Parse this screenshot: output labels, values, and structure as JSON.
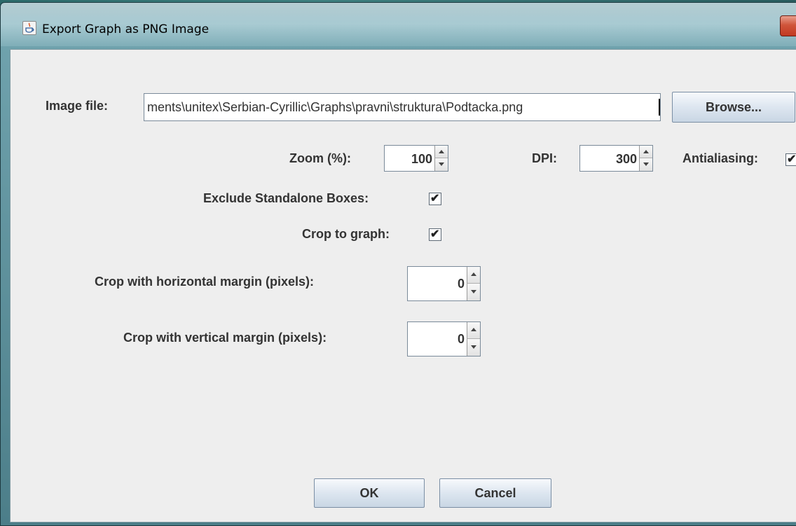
{
  "window": {
    "title": "Export Graph as PNG Image"
  },
  "form": {
    "image_file_label": "Image file:",
    "image_file_value": "ments\\unitex\\Serbian-Cyrillic\\Graphs\\pravni\\struktura\\Podtacka.png",
    "browse_label": "Browse...",
    "zoom_label": "Zoom (%):",
    "zoom_value": "100",
    "dpi_label": "DPI:",
    "dpi_value": "300",
    "antialiasing_label": "Antialiasing:",
    "exclude_label": "Exclude Standalone Boxes:",
    "exclude_checked": true,
    "crop_label": "Crop to graph:",
    "crop_checked": true,
    "hmargin_label": "Crop with horizontal margin (pixels):",
    "hmargin_value": "0",
    "vmargin_label": "Crop with vertical margin (pixels):",
    "vmargin_value": "0"
  },
  "buttons": {
    "ok": "OK",
    "cancel": "Cancel"
  },
  "icons": {
    "title": "java-cup-icon",
    "close": "close-icon",
    "check": "checkmark-icon"
  },
  "colors": {
    "dialog_bg": "#eeeeee",
    "close_button": "#c94a31"
  }
}
